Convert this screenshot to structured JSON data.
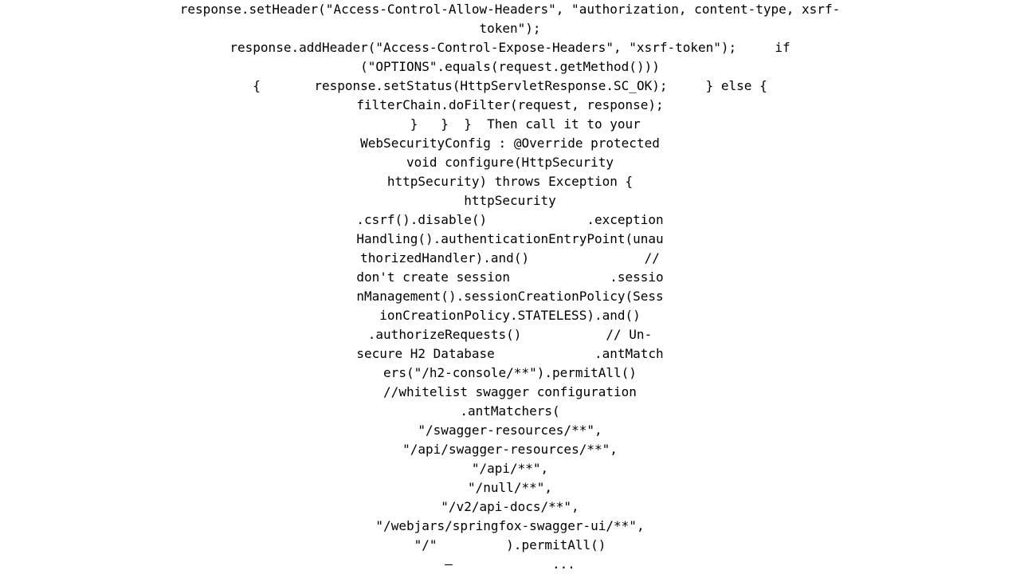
{
  "code": {
    "lines": [
      "response.setHeader(\"Access-Control-Allow-Headers\", \"authorization, content-type, xsrf-token\");",
      "response.addHeader(\"Access-Control-Expose-Headers\", \"xsrf-token\");     if (\"OPTIONS\".equals(request.getMethod()))",
      "{       response.setStatus(HttpServletResponse.SC_OK);     } else {",
      "filterChain.doFilter(request, response);",
      "    }   }  }  Then call it to your WebSecurityConfig : @Override protected void configure(HttpSecurity httpSecurity) throws Exception {",
      "httpSecurity",
      ".csrf().disable()             .exceptionHandling().authenticationEntryPoint(unauthorizedHandler).and()               // don't create session             .sessionManagement().sessionCreationPolicy(SessionCreationPolicy.STATELESS).and()",
      ".authorizeRequests()           // Un-secure H2 Database             .antMatchers(\"/h2-console/**\").permitAll()",
      "//whitelist swagger configuration             .antMatchers(",
      "\"/swagger-resources/**\",",
      "\"/api/swagger-resources/**\",",
      "\"/api/**\",",
      "\"/null/**\",",
      "\"/v2/api-docs/**\",",
      "\"/webjars/springfox-swagger-ui/**\",",
      "\"/\"         ).permitAll()",
      "—             ..."
    ]
  }
}
